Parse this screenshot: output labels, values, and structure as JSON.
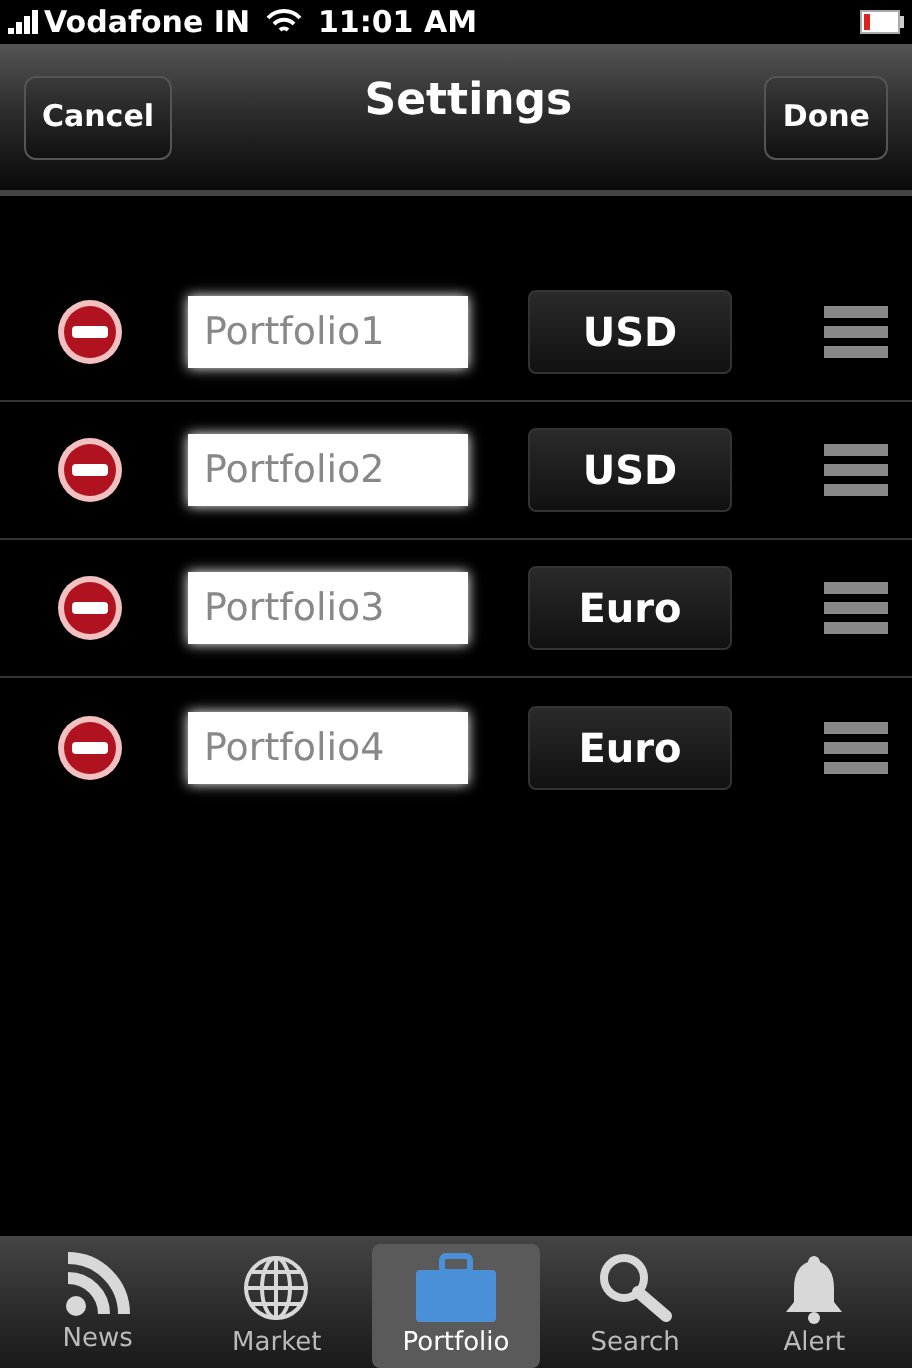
{
  "status_bar": {
    "carrier": "Vodafone IN",
    "time": "11:01 AM"
  },
  "nav_bar": {
    "left_button": "Cancel",
    "title": "Settings",
    "right_button": "Done"
  },
  "portfolios": [
    {
      "name": "Portfolio1",
      "currency": "USD"
    },
    {
      "name": "Portfolio2",
      "currency": "USD"
    },
    {
      "name": "Portfolio3",
      "currency": "Euro"
    },
    {
      "name": "Portfolio4",
      "currency": "Euro"
    }
  ],
  "tabs": [
    {
      "label": "News",
      "kind": "rss",
      "selected": false
    },
    {
      "label": "Market",
      "kind": "globe",
      "selected": false
    },
    {
      "label": "Portfolio",
      "kind": "briefcase",
      "selected": true
    },
    {
      "label": "Search",
      "kind": "search",
      "selected": false
    },
    {
      "label": "Alert",
      "kind": "bell",
      "selected": false
    }
  ]
}
